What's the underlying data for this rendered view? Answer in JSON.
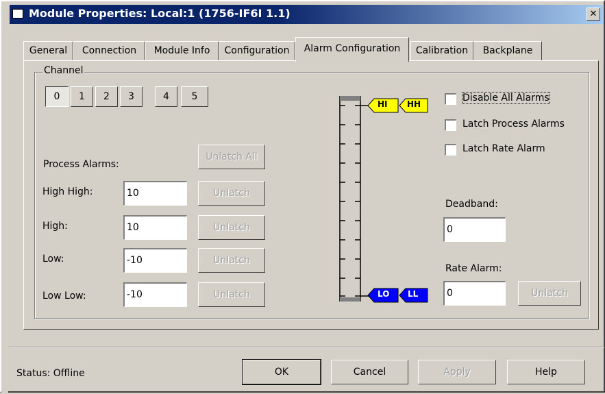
{
  "window": {
    "title": "Module Properties: Local:1 (1756-IF6I 1.1)",
    "close_glyph": "✕"
  },
  "tabs": [
    {
      "label": "General"
    },
    {
      "label": "Connection"
    },
    {
      "label": "Module Info"
    },
    {
      "label": "Configuration"
    },
    {
      "label": "Alarm Configuration"
    },
    {
      "label": "Calibration"
    },
    {
      "label": "Backplane"
    }
  ],
  "active_tab": "Alarm Configuration",
  "channel": {
    "group_label": "Channel",
    "buttons": [
      "0",
      "1",
      "2",
      "3",
      "4",
      "5"
    ],
    "selected": "0"
  },
  "process_alarms": {
    "label": "Process Alarms:",
    "unlatch_all": "Unlatch All",
    "rows": [
      {
        "label": "High High:",
        "value": "10",
        "button": "Unlatch"
      },
      {
        "label": "High:",
        "value": "10",
        "button": "Unlatch"
      },
      {
        "label": "Low:",
        "value": "-10",
        "button": "Unlatch"
      },
      {
        "label": "Low Low:",
        "value": "-10",
        "button": "Unlatch"
      }
    ]
  },
  "alarm_bar": {
    "markers": {
      "hi": "HI",
      "hh": "HH",
      "lo": "LO",
      "ll": "LL"
    },
    "colors": {
      "high": "#ffff00",
      "low": "#0000ff",
      "low_text": "#ffffff"
    }
  },
  "options": {
    "disable_all": {
      "label": "Disable All Alarms",
      "checked": false
    },
    "latch_process": {
      "label": "Latch Process Alarms",
      "checked": false
    },
    "latch_rate": {
      "label": "Latch Rate Alarm",
      "checked": false
    }
  },
  "deadband": {
    "label": "Deadband:",
    "value": "0"
  },
  "rate_alarm": {
    "label": "Rate Alarm:",
    "value": "0",
    "button": "Unlatch"
  },
  "footer": {
    "status": "Status:  Offline",
    "ok": "OK",
    "cancel": "Cancel",
    "apply": "Apply",
    "help": "Help"
  }
}
